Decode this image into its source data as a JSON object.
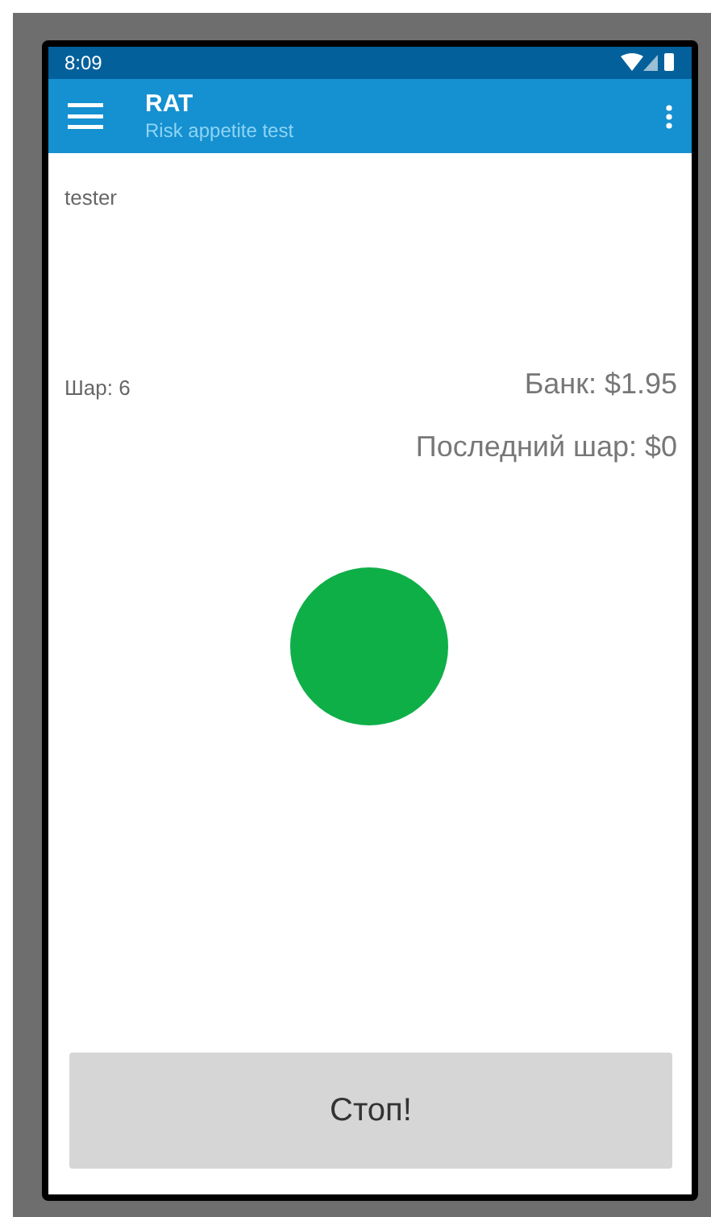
{
  "status_bar": {
    "time": "8:09"
  },
  "app_bar": {
    "title": "RAT",
    "subtitle": "Risk appetite test"
  },
  "user": "tester",
  "ball_count": "Шар: 6",
  "bank": "Банк: $1.95",
  "last_ball": "Последний шар: $0",
  "ball": {
    "color": "#0faf48"
  },
  "stop_button": "Стоп!"
}
